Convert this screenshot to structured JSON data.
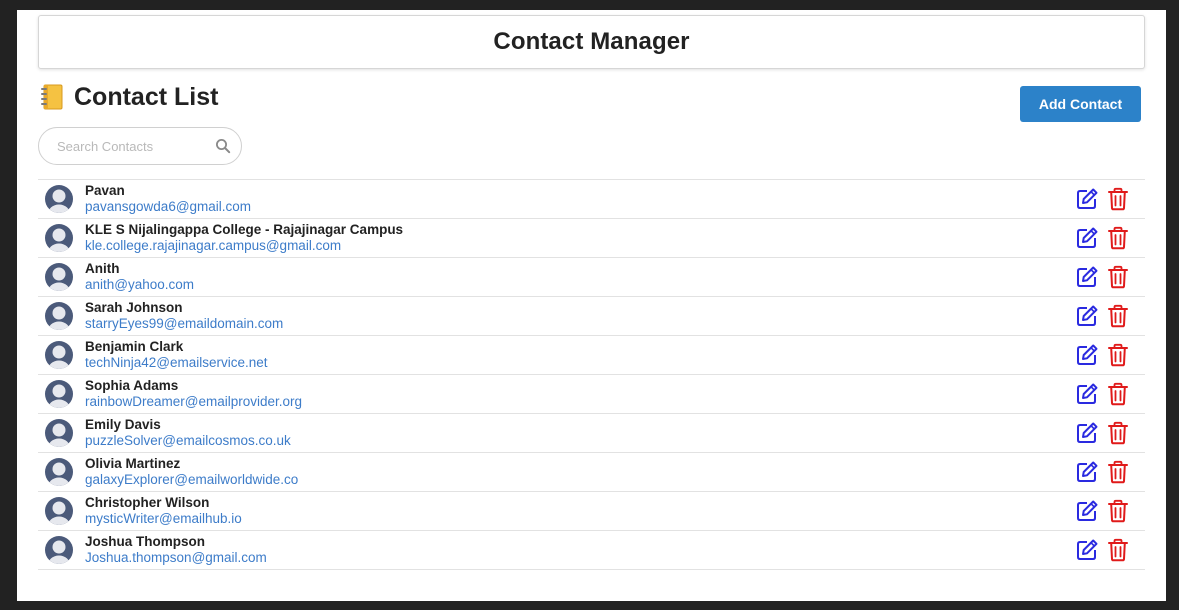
{
  "header": {
    "title": "Contact Manager"
  },
  "contacts_section": {
    "title": "Contact List",
    "add_button_label": "Add Contact",
    "search_placeholder": "Search Contacts"
  },
  "colors": {
    "accent": "#2c82c9",
    "email_link": "#3d7cc9",
    "edit_icon": "#2a2ae0",
    "delete_icon": "#e01a1a",
    "avatar": "#4b5a7a"
  },
  "icons": {
    "heading": "notebook-icon",
    "search": "search-icon",
    "avatar": "user-avatar-icon",
    "edit": "edit-icon",
    "delete": "trash-icon"
  },
  "contacts": [
    {
      "name": "Pavan",
      "email": "pavansgowda6@gmail.com"
    },
    {
      "name": "KLE S Nijalingappa College - Rajajinagar Campus",
      "email": "kle.college.rajajinagar.campus@gmail.com"
    },
    {
      "name": "Anith",
      "email": "anith@yahoo.com"
    },
    {
      "name": "Sarah Johnson",
      "email": "starryEyes99@emaildomain.com"
    },
    {
      "name": "Benjamin Clark",
      "email": "techNinja42@emailservice.net"
    },
    {
      "name": "Sophia Adams",
      "email": "rainbowDreamer@emailprovider.org"
    },
    {
      "name": "Emily Davis",
      "email": "puzzleSolver@emailcosmos.co.uk"
    },
    {
      "name": "Olivia Martinez",
      "email": "galaxyExplorer@emailworldwide.co"
    },
    {
      "name": "Christopher Wilson",
      "email": "mysticWriter@emailhub.io"
    },
    {
      "name": "Joshua Thompson",
      "email": "Joshua.thompson@gmail.com"
    }
  ]
}
